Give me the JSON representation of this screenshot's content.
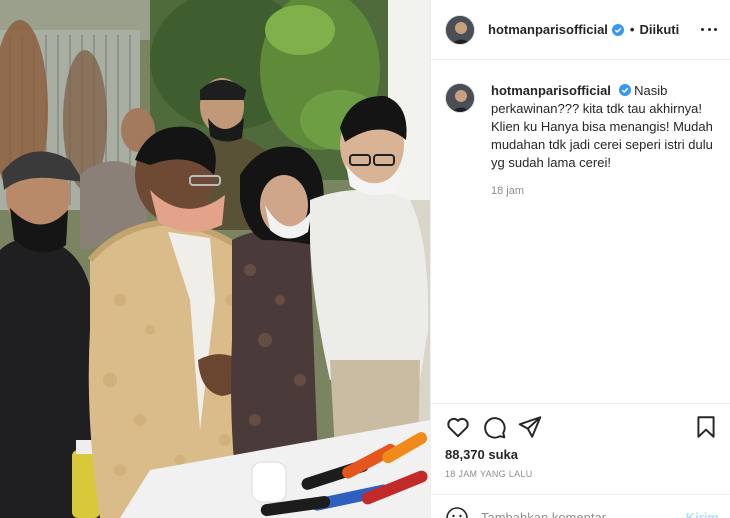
{
  "post": {
    "username": "hotmanparisofficial",
    "verified": true,
    "follow_separator": "•",
    "follow_status": "Diikuti",
    "caption": "Nasib perkawinan??? kita tdk tau akhirnya! Klien ku Hanya bisa menangis! Mudah mudahan tdk jadi cerei seperi istri dulu yg sudah lama cerei!",
    "caption_time": "18 jam",
    "likes": "88,370 suka",
    "post_time": "18 JAM YANG LALU"
  },
  "comment_box": {
    "placeholder": "Tambahkan komentar...",
    "post_label": "Kirim"
  },
  "icons": {
    "verified": "verified-badge-icon",
    "more": "more-options-icon",
    "like": "heart-icon",
    "comment": "comment-bubble-icon",
    "share": "paper-plane-icon",
    "save": "bookmark-icon",
    "emoji": "smiley-icon"
  },
  "colors": {
    "verified_blue": "#3897f0",
    "post_button": "#b2dffc",
    "secondary_text": "#8e8e8e"
  }
}
